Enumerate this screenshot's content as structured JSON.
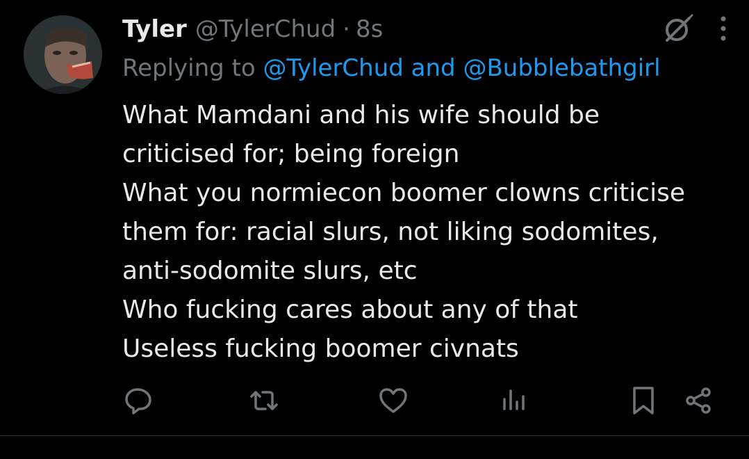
{
  "tweet": {
    "author_name": "Tyler",
    "author_handle": "@TylerChud",
    "separator": "·",
    "time": "8s",
    "replying_prefix": "Replying to ",
    "replying_to": [
      "@TylerChud",
      "@Bubblebathgirl"
    ],
    "replying_joiner": " and ",
    "body_lines": [
      "What Mamdani and  his wife should be",
      "criticised for; being foreign",
      "What you normiecon boomer clowns criticise",
      "them for: racial slurs, not liking sodomites,",
      "anti-sodomite slurs, etc",
      "Who fucking cares about any of that",
      "Useless fucking boomer civnats"
    ]
  },
  "icons": {
    "top": [
      "grok-icon",
      "more-options-icon"
    ],
    "actions": [
      "reply-icon",
      "retweet-icon",
      "like-icon",
      "views-icon",
      "bookmark-icon",
      "share-icon"
    ]
  },
  "colors": {
    "background": "#000000",
    "text": "#e7e9ea",
    "muted": "#71767b",
    "link": "#1d9bf0",
    "divider": "#2f3336"
  }
}
